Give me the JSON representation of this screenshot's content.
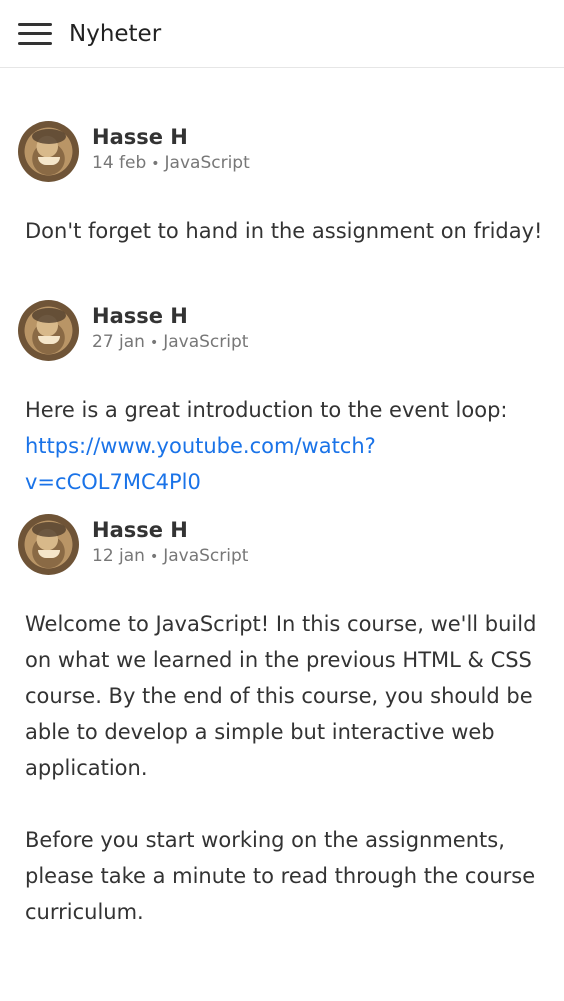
{
  "header": {
    "title": "Nyheter",
    "menu_icon": "menu-icon"
  },
  "posts": [
    {
      "author": "Hasse H",
      "date": "14 feb",
      "separator": "•",
      "course": "JavaScript",
      "body": [
        "Don't forget to hand in the assignment on friday!"
      ]
    },
    {
      "author": "Hasse H",
      "date": "27 jan",
      "separator": "•",
      "course": "JavaScript",
      "body": [
        "Here is a great introduction to the event loop:"
      ],
      "link": "https://www.youtube.com/watch?v=cCOL7MC4Pl0"
    },
    {
      "author": "Hasse H",
      "date": "12 jan",
      "separator": "•",
      "course": "JavaScript",
      "body": [
        "Welcome to JavaScript! In this course, we'll build on what we learned in the previous HTML & CSS course. By the end of this course, you should be able to develop a simple but interactive web application.",
        "Before you start working on the assignments, please take a minute to read through the course curriculum."
      ]
    }
  ]
}
